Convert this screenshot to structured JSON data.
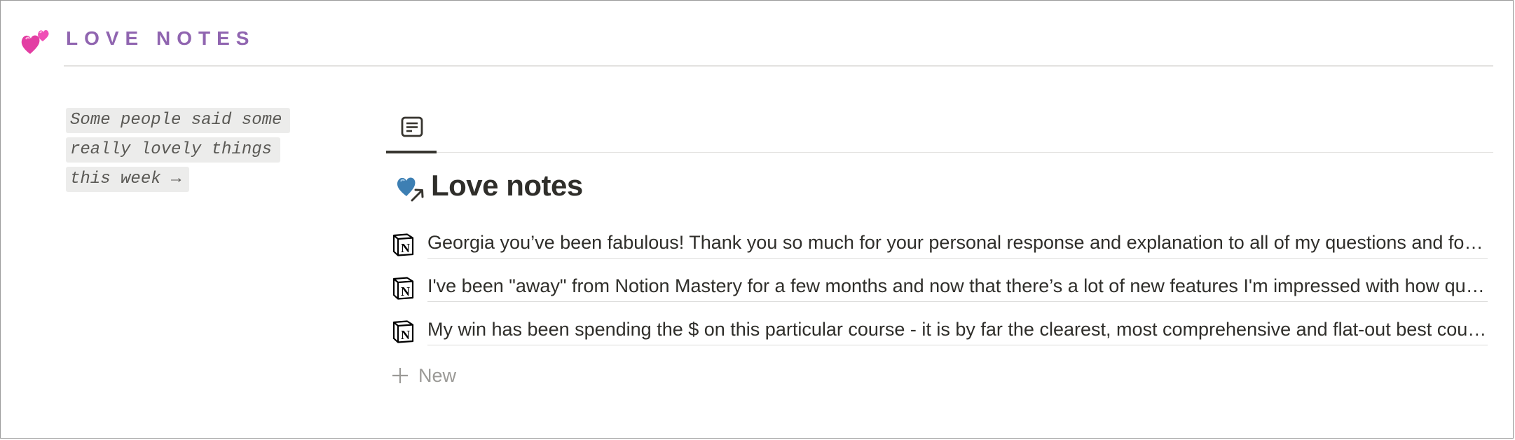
{
  "header": {
    "emoji": "two-hearts-icon",
    "title": "LOVE NOTES",
    "title_color": "#9065b0"
  },
  "callout": {
    "lines": [
      "Some people said some",
      "really lovely things",
      "this week →"
    ]
  },
  "tabs": [
    {
      "icon": "table-view-icon",
      "active": true
    }
  ],
  "view": {
    "icon": "blue-heart-linked-icon",
    "title": "Love notes"
  },
  "list": {
    "items": [
      {
        "icon": "notion-logo-icon",
        "text": "Georgia you’ve been fabulous! Thank you so much for your personal response and explanation to all of my questions and for taking the time"
      },
      {
        "icon": "notion-logo-icon",
        "text": "I've been \"away\" from Notion Mastery for a few months and now that there’s a lot of new features I'm impressed with how quickly"
      },
      {
        "icon": "notion-logo-icon",
        "text": "My win has been spending the $ on this particular course - it is by far the clearest, most comprehensive and flat-out best course"
      }
    ],
    "new_label": "New"
  }
}
